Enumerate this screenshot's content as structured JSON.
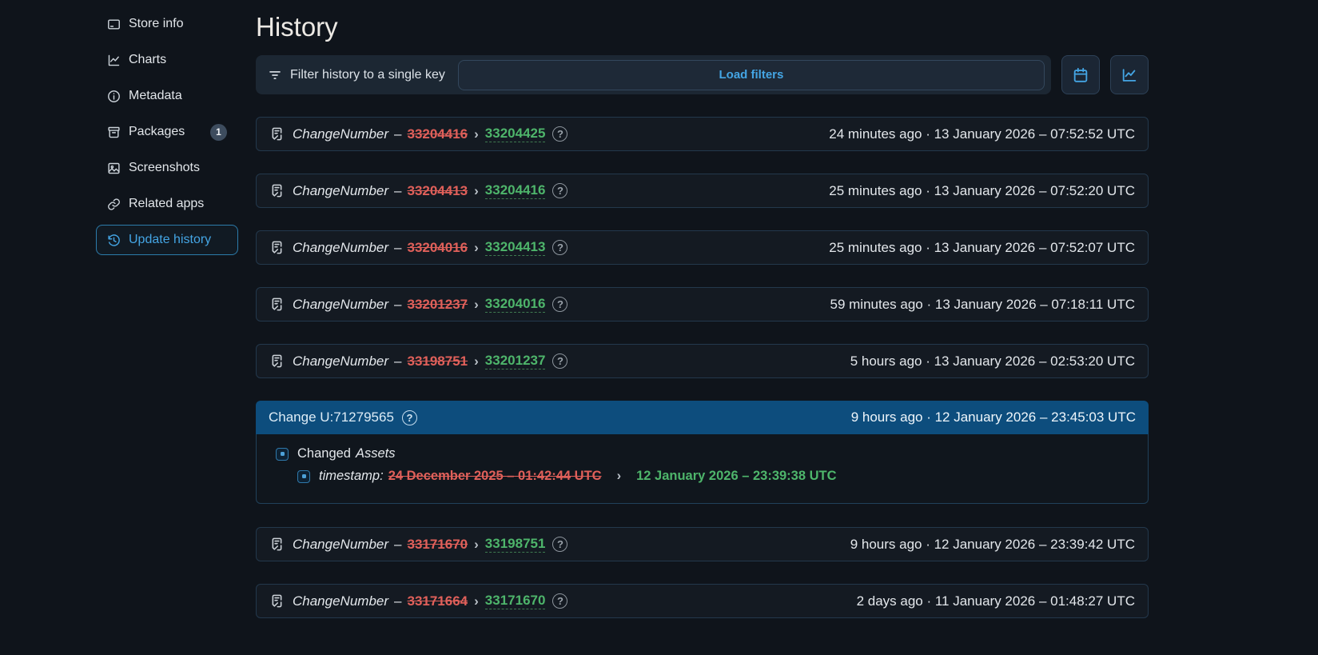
{
  "page": {
    "title": "History"
  },
  "colors": {
    "accent": "#44a5e4",
    "removed": "#e0605a",
    "added": "#4eb56b",
    "highlight": "#0d4d7d"
  },
  "sidebar": {
    "items": [
      {
        "label": "Store info"
      },
      {
        "label": "Charts"
      },
      {
        "label": "Metadata"
      },
      {
        "label": "Packages",
        "badge": "1"
      },
      {
        "label": "Screenshots"
      },
      {
        "label": "Related apps"
      },
      {
        "label": "Update history",
        "active": true
      }
    ]
  },
  "filter_bar": {
    "label": "Filter history to a single key",
    "select_value": "Load filters"
  },
  "history": {
    "separators": {
      "dash": "–",
      "arrow": "›"
    },
    "help_glyph": "?",
    "items": [
      {
        "type": "row",
        "key": "ChangeNumber",
        "old": "33204416",
        "new": "33204425",
        "timestamp": "24 minutes ago · 13 January 2026 – 07:52:52 UTC"
      },
      {
        "type": "row",
        "key": "ChangeNumber",
        "old": "33204413",
        "new": "33204416",
        "timestamp": "25 minutes ago · 13 January 2026 – 07:52:20 UTC"
      },
      {
        "type": "row",
        "key": "ChangeNumber",
        "old": "33204016",
        "new": "33204413",
        "timestamp": "25 minutes ago · 13 January 2026 – 07:52:07 UTC"
      },
      {
        "type": "row",
        "key": "ChangeNumber",
        "old": "33201237",
        "new": "33204016",
        "timestamp": "59 minutes ago · 13 January 2026 – 07:18:11 UTC"
      },
      {
        "type": "row",
        "key": "ChangeNumber",
        "old": "33198751",
        "new": "33201237",
        "timestamp": "5 hours ago · 13 January 2026 – 02:53:20 UTC"
      },
      {
        "type": "expanded",
        "title": "Change U:71279565",
        "timestamp": "9 hours ago · 12 January 2026 – 23:45:03 UTC",
        "changed_label": "Changed",
        "changed_field": "Assets",
        "sub_key": "timestamp:",
        "old": "24 December 2025 – 01:42:44 UTC",
        "new": "12 January 2026 – 23:39:38 UTC"
      },
      {
        "type": "row",
        "key": "ChangeNumber",
        "old": "33171670",
        "new": "33198751",
        "timestamp": "9 hours ago · 12 January 2026 – 23:39:42 UTC"
      },
      {
        "type": "row",
        "key": "ChangeNumber",
        "old": "33171664",
        "new": "33171670",
        "timestamp": "2 days ago · 11 January 2026 – 01:48:27 UTC"
      }
    ]
  }
}
